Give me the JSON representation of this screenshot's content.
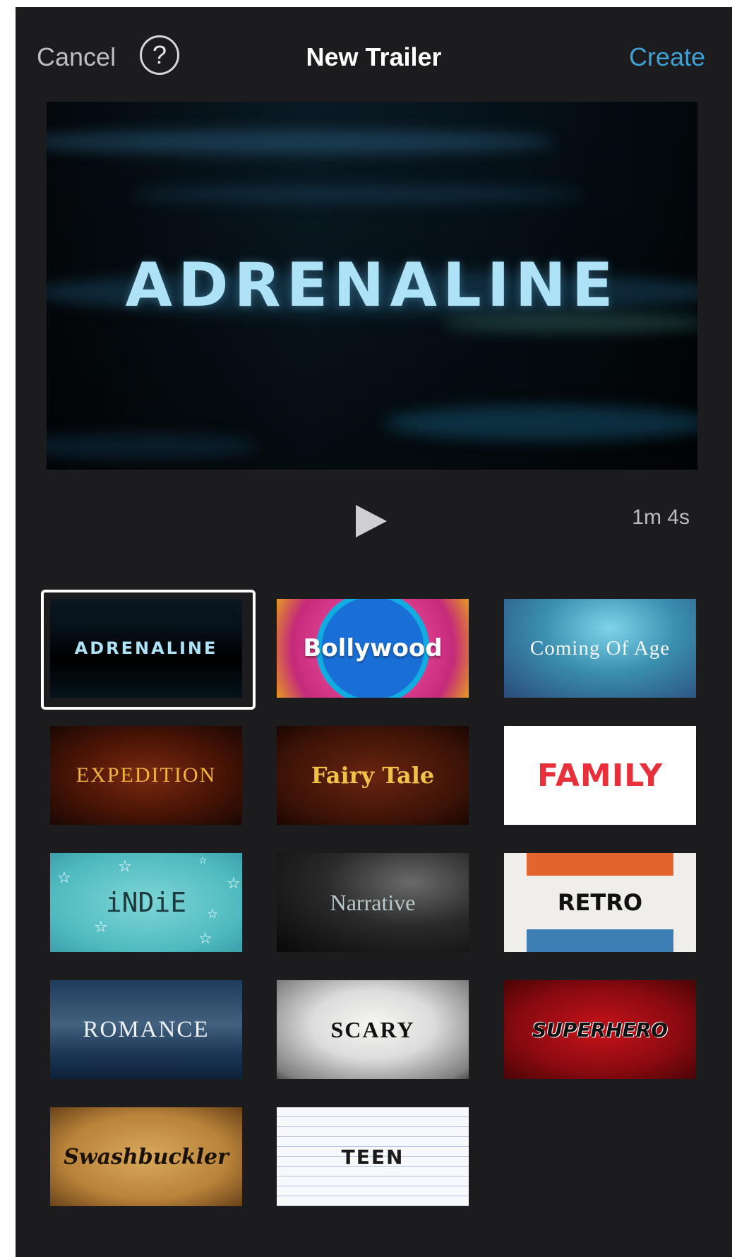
{
  "nav": {
    "cancel_label": "Cancel",
    "help_label": "?",
    "title": "New Trailer",
    "create_label": "Create"
  },
  "preview": {
    "title": "ADRENALINE",
    "duration": "1m 4s"
  },
  "templates": [
    {
      "label": "ADRENALINE",
      "selected": true
    },
    {
      "label": "Bollywood",
      "selected": false
    },
    {
      "label": "Coming Of Age",
      "selected": false
    },
    {
      "label": "EXPEDITION",
      "selected": false
    },
    {
      "label": "Fairy Tale",
      "selected": false
    },
    {
      "label": "FAMILY",
      "selected": false
    },
    {
      "label": "iNDiE",
      "selected": false
    },
    {
      "label": "Narrative",
      "selected": false
    },
    {
      "label": "RETRO",
      "selected": false
    },
    {
      "label": "ROMANCE",
      "selected": false
    },
    {
      "label": "SCARY",
      "selected": false
    },
    {
      "label": "SUPERHERO",
      "selected": false
    },
    {
      "label": "Swashbuckler",
      "selected": false
    },
    {
      "label": "TEEN",
      "selected": false
    }
  ],
  "colors": {
    "background": "#1c1c1e",
    "accent": "#3ea1d6",
    "nav_text": "#bdbdc2"
  }
}
